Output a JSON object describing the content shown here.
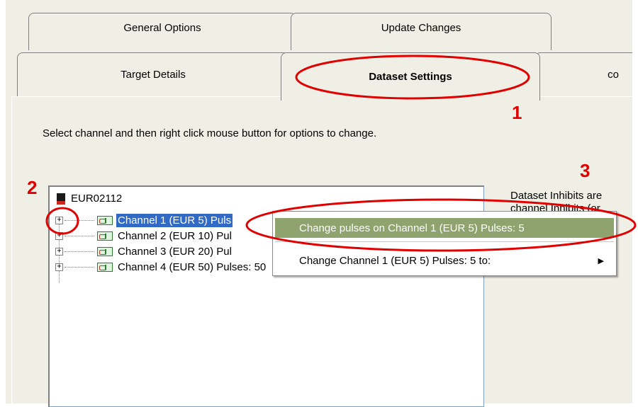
{
  "tabs": {
    "row_back": [
      {
        "label": "General Options"
      },
      {
        "label": "Update Changes"
      }
    ],
    "row_front": [
      {
        "label": "Target Details"
      },
      {
        "label": "Dataset Settings"
      },
      {
        "label": "co"
      }
    ]
  },
  "instruction": "Select channel and then right click mouse button for options to change.",
  "tree": {
    "root": "EUR02112",
    "channels": [
      {
        "label": "Channel 1 (EUR 5) Puls"
      },
      {
        "label": "Channel 2 (EUR 10) Pul"
      },
      {
        "label": "Channel 3 (EUR 20) Pul"
      },
      {
        "label": "Channel 4 (EUR 50) Pulses: 50"
      }
    ]
  },
  "side_text": {
    "line1": "Dataset Inhibits are",
    "line2": "channel Inhibits (or"
  },
  "context_menu": {
    "item1": "Change pulses on Channel 1 (EUR 5) Pulses: 5",
    "item2": "Change Channel 1 (EUR 5) Pulses: 5 to:"
  },
  "annotations": {
    "n1": "1",
    "n2": "2",
    "n3": "3",
    "color": "#e00000"
  }
}
